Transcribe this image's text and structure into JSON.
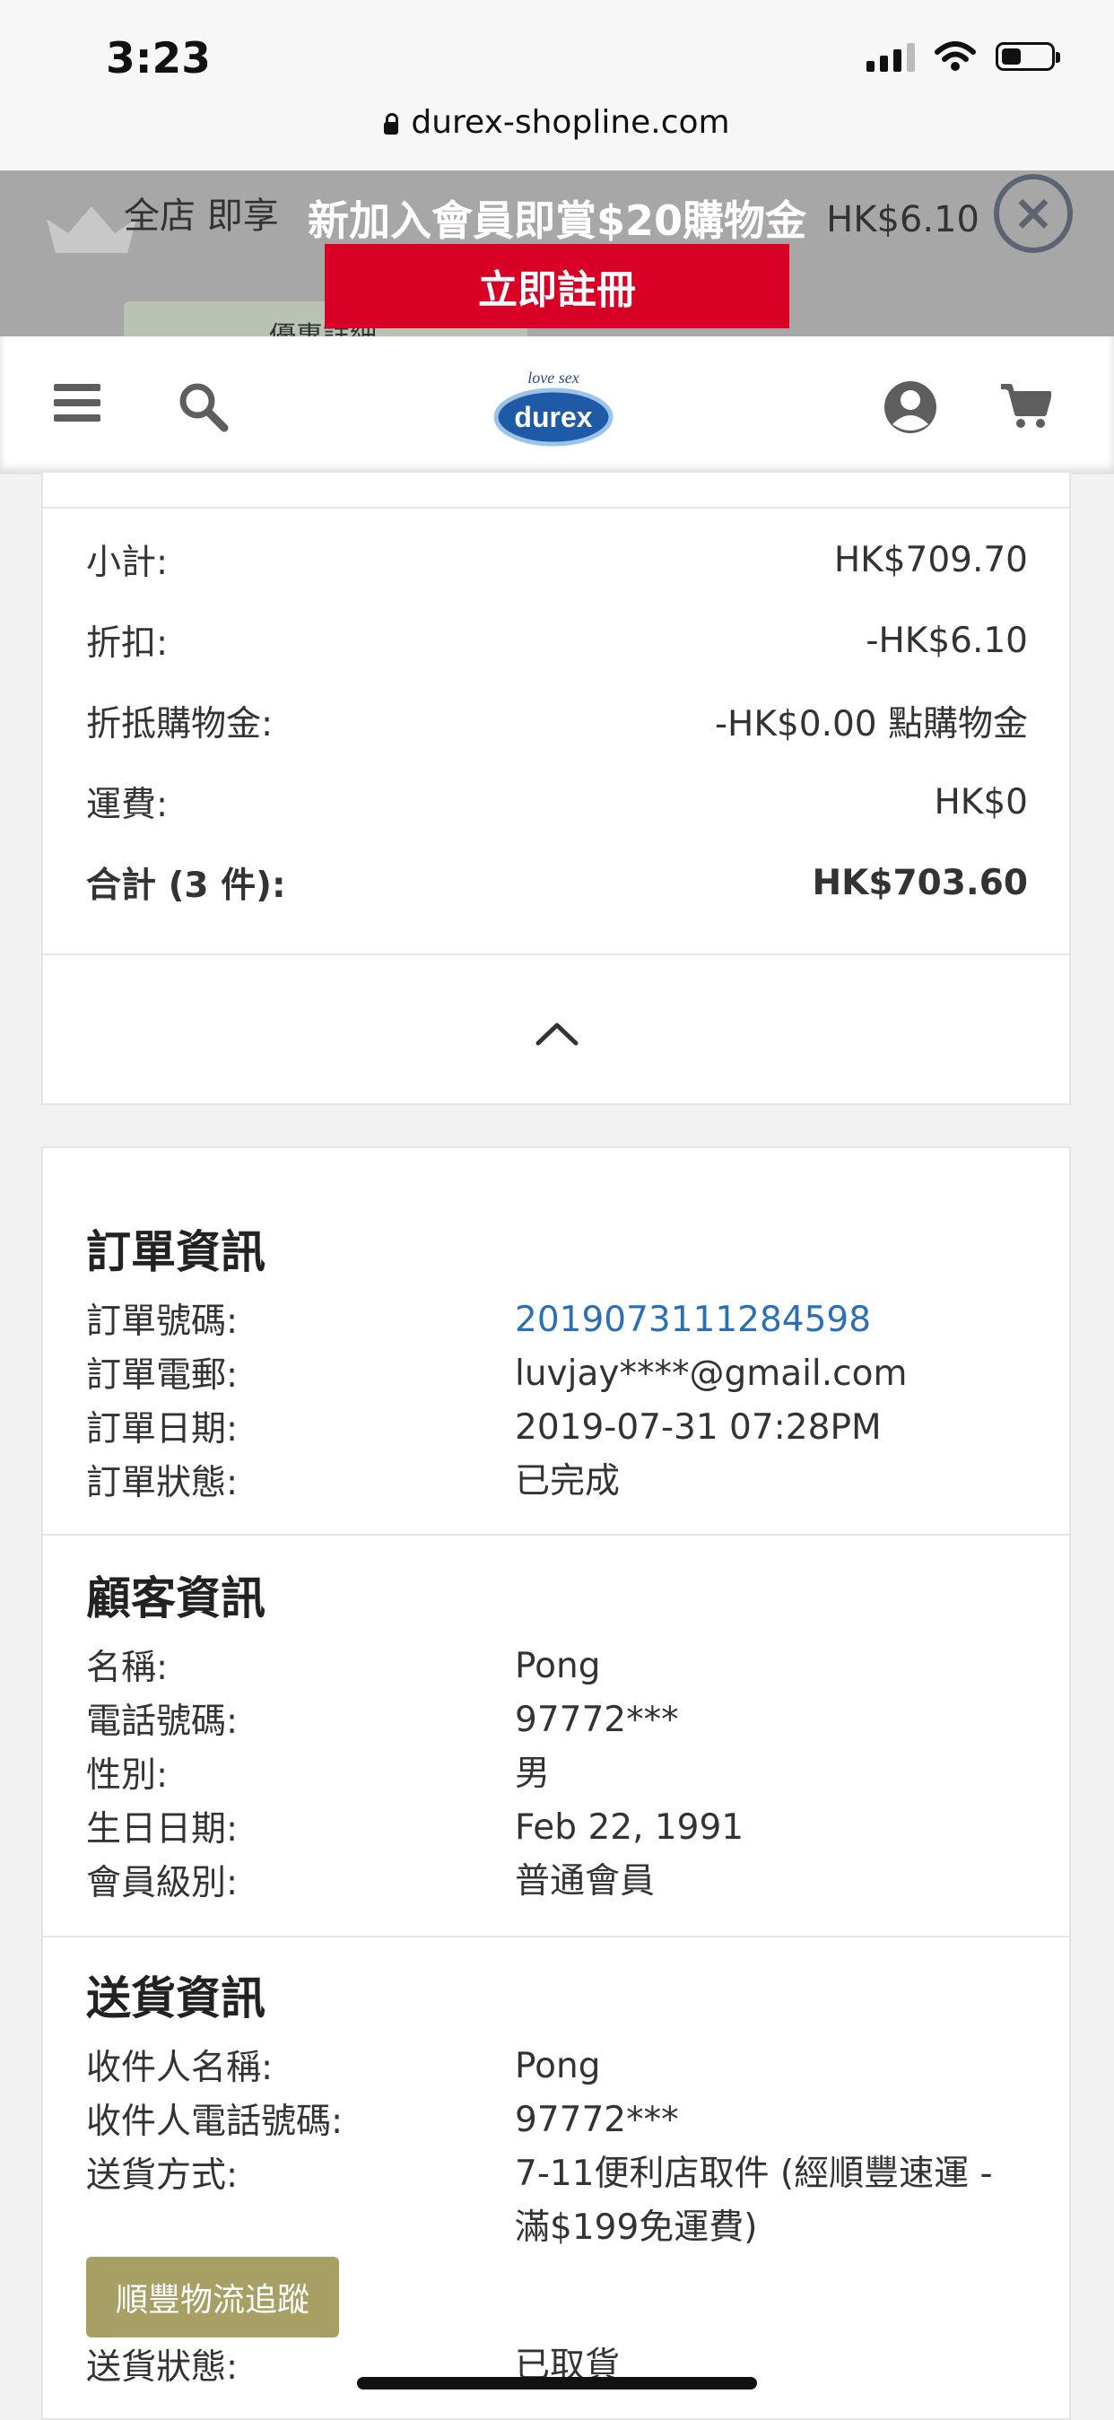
{
  "status_bar": {
    "time": "3:23"
  },
  "browser": {
    "url": "durex-shopline.com"
  },
  "promo_banner": {
    "behind_text": "全店 即享",
    "behind_price": "HK$6.10",
    "behind_pill_text": "優惠詳細",
    "title": "新加入會員即賞$20購物金",
    "register_label": "立即註冊",
    "close_symbol": "×"
  },
  "header": {
    "logo_text_top": "love sex",
    "logo_text": "durex"
  },
  "summary": {
    "rows": [
      {
        "label": "小計:",
        "value": "HK$709.70"
      },
      {
        "label": "折扣:",
        "value": "-HK$6.10"
      },
      {
        "label": "折抵購物金:",
        "value": "-HK$0.00 點購物金"
      },
      {
        "label": "運費:",
        "value": "HK$0"
      },
      {
        "label": "合計 (3 件):",
        "value": "HK$703.60"
      }
    ]
  },
  "order_info": {
    "title": "訂單資訊",
    "rows": [
      {
        "label": "訂單號碼:",
        "value": "2019073111284598"
      },
      {
        "label": "訂單電郵:",
        "value": "luvjay****@gmail.com"
      },
      {
        "label": "訂單日期:",
        "value": "2019-07-31 07:28PM"
      },
      {
        "label": "訂單狀態:",
        "value": "已完成"
      }
    ]
  },
  "customer_info": {
    "title": "顧客資訊",
    "rows": [
      {
        "label": "名稱:",
        "value": "Pong"
      },
      {
        "label": "電話號碼:",
        "value": "97772***"
      },
      {
        "label": "性別:",
        "value": "男"
      },
      {
        "label": "生日日期:",
        "value": "Feb 22, 1991"
      },
      {
        "label": "會員級別:",
        "value": "普通會員"
      }
    ]
  },
  "delivery_info": {
    "title": "送貨資訊",
    "rows": [
      {
        "label": "收件人名稱:",
        "value": "Pong"
      },
      {
        "label": "收件人電話號碼:",
        "value": "97772***"
      },
      {
        "label": "送貨方式:",
        "value": "7-11便利店取件 (經順豐速運 - 滿$199免運費)"
      },
      {
        "label": "送貨狀態:",
        "value": "已取貨"
      }
    ],
    "track_label": "順豐物流追蹤"
  },
  "colors": {
    "register": "#d90025",
    "link": "#2b6fb6",
    "track": "#a89f64"
  }
}
